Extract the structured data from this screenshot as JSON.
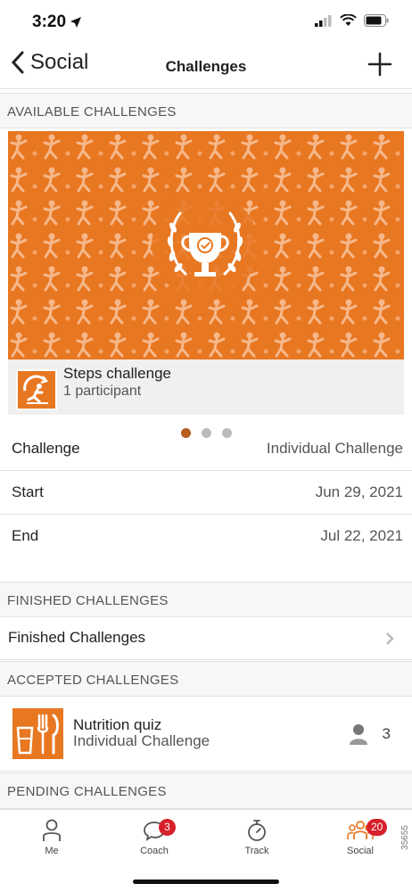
{
  "status_bar": {
    "time": "3:20"
  },
  "nav": {
    "back_label": "Social",
    "title": "Challenges"
  },
  "sections": {
    "available": "AVAILABLE CHALLENGES",
    "finished": "FINISHED CHALLENGES",
    "accepted": "ACCEPTED CHALLENGES",
    "pending": "PENDING CHALLENGES"
  },
  "featured": {
    "name": "Steps challenge",
    "participants": "1 participant",
    "carousel": {
      "pages": 3,
      "active": 1
    },
    "details": [
      {
        "label": "Challenge",
        "value": "Individual Challenge"
      },
      {
        "label": "Start",
        "value": "Jun 29, 2021"
      },
      {
        "label": "End",
        "value": "Jul 22, 2021"
      }
    ]
  },
  "finished_link": "Finished Challenges",
  "accepted_item": {
    "name": "Nutrition quiz",
    "type": "Individual Challenge",
    "count": "3"
  },
  "tabs": [
    {
      "label": "Me",
      "icon": "person-icon"
    },
    {
      "label": "Coach",
      "icon": "chat-icon",
      "badge": "3"
    },
    {
      "label": "Track",
      "icon": "stopwatch-icon"
    },
    {
      "label": "Social",
      "icon": "group-icon",
      "badge": "20",
      "active": true
    }
  ],
  "side_id": "35655",
  "colors": {
    "accent": "#e87722",
    "badge": "#d6202a",
    "dot_active": "#b75d1e"
  }
}
